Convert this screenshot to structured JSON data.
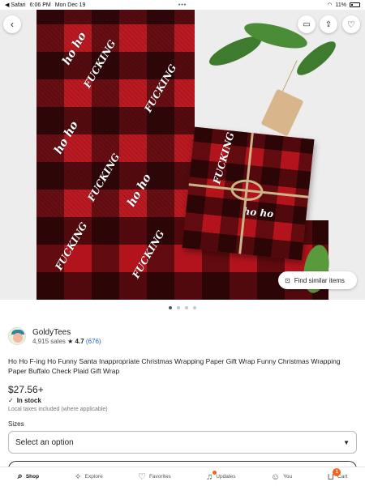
{
  "status_bar": {
    "back_label": "◀ Safari",
    "time": "6:06 PM",
    "date": "Mon Dec 19",
    "battery": "11%"
  },
  "hero": {
    "find_similar_label": "Find similar items",
    "image_index": 1,
    "image_count": 4,
    "print_phrases": [
      "ho ho",
      "FUCKING",
      "ho"
    ]
  },
  "shop": {
    "name": "GoldyTees",
    "sales": "4,915 sales",
    "rating": "★ 4.7",
    "reviews": "(676)"
  },
  "listing": {
    "title": "Ho Ho F-ing Ho Funny Santa Inappropriate Christmas Wrapping Paper Gift Wrap Funny Christmas Wrapping Paper Buffalo Check Plaid Gift Wrap",
    "price": "$27.56+",
    "stock": "In stock",
    "tax_note": "Local taxes included (where applicable)"
  },
  "options": {
    "sizes_label": "Sizes",
    "sizes_value": "Select an option"
  },
  "tabbar": {
    "tabs": [
      {
        "label": "Shop",
        "icon": "search-icon"
      },
      {
        "label": "Explore",
        "icon": "sparkle-icon"
      },
      {
        "label": "Favorites",
        "icon": "heart-icon"
      },
      {
        "label": "Updates",
        "icon": "bell-icon"
      },
      {
        "label": "You",
        "icon": "person-icon"
      },
      {
        "label": "Cart",
        "icon": "cart-icon"
      }
    ],
    "cart_count": "1"
  },
  "colors": {
    "accent": "#f1641e",
    "link": "#2b5fc4",
    "plaid_red": "#b3141c"
  }
}
